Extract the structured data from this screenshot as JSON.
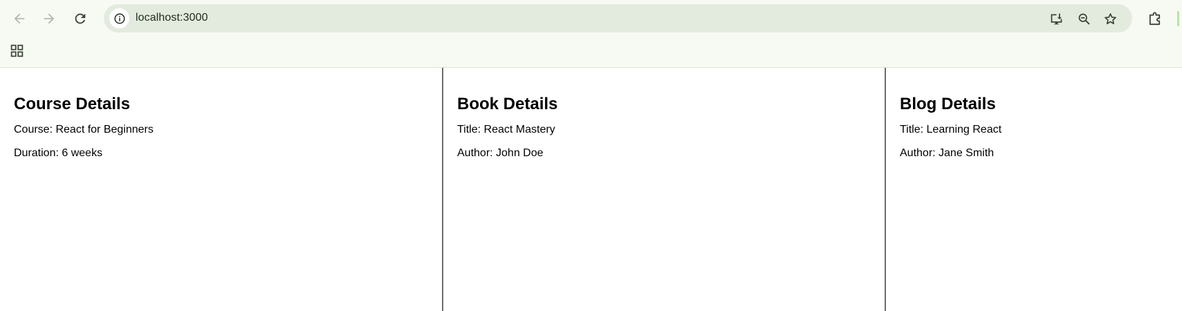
{
  "browser": {
    "url": "localhost:3000",
    "icons": {
      "back": "arrow-left-icon",
      "forward": "arrow-right-icon",
      "reload": "reload-icon",
      "site_info": "info-icon",
      "install": "install-app-icon",
      "zoom": "zoom-out-icon",
      "bookmark": "star-icon",
      "extensions": "puzzle-icon",
      "apps": "apps-grid-icon"
    }
  },
  "panels": [
    {
      "heading": "Course Details",
      "line1": "Course: React for Beginners",
      "line2": "Duration: 6 weeks"
    },
    {
      "heading": "Book Details",
      "line1": "Title: React Mastery",
      "line2": "Author: John Doe"
    },
    {
      "heading": "Blog Details",
      "line1": "Title: Learning React",
      "line2": "Author: Jane Smith"
    }
  ]
}
